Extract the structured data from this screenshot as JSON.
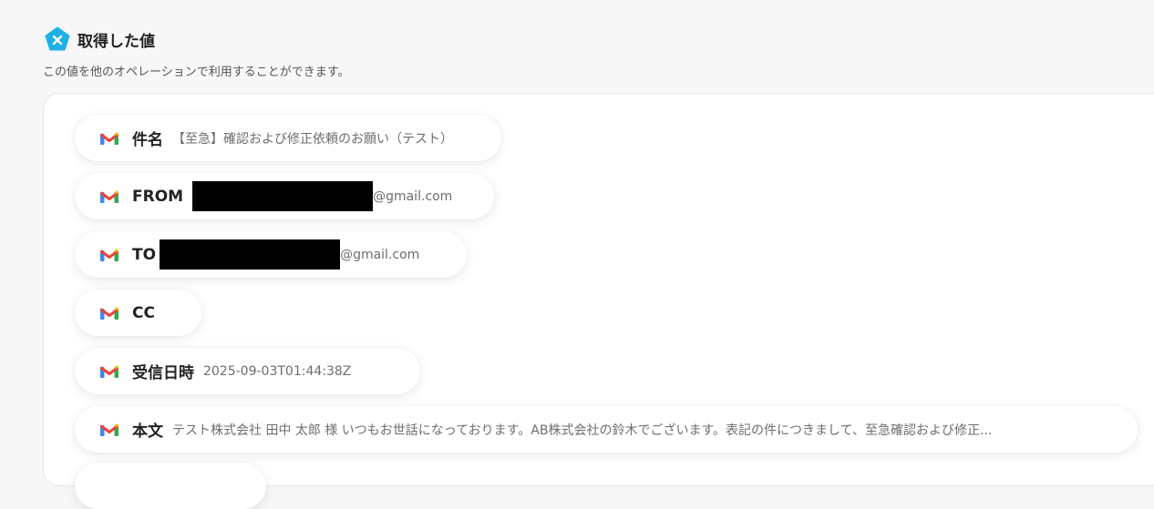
{
  "section": {
    "title": "取得した値",
    "description": "この値を他のオペレーションで利用することができます。"
  },
  "fields": [
    {
      "label": "件名",
      "value": "【至急】確認および修正依頼のお願い（テスト）"
    },
    {
      "label": "FROM",
      "value": "@gmail.com"
    },
    {
      "label": "TO",
      "value": "@gmail.com"
    },
    {
      "label": "CC",
      "value": ""
    },
    {
      "label": "受信日時",
      "value": "2025-09-03T01:44:38Z"
    },
    {
      "label": "本文",
      "value": "テスト株式会社 田中 太郎 様 いつもお世話になっております。AB株式会社の鈴木でございます。表記の件につきまして、至急確認および修正..."
    }
  ],
  "icons": {
    "section_icon": "yoom-logo-icon",
    "field_icon": "gmail-icon"
  },
  "colors": {
    "logo": "#1fb0e6",
    "gmail_red": "#ea4335",
    "gmail_blue": "#4285f4",
    "gmail_green": "#34a853",
    "gmail_yellow": "#fbbc04"
  }
}
